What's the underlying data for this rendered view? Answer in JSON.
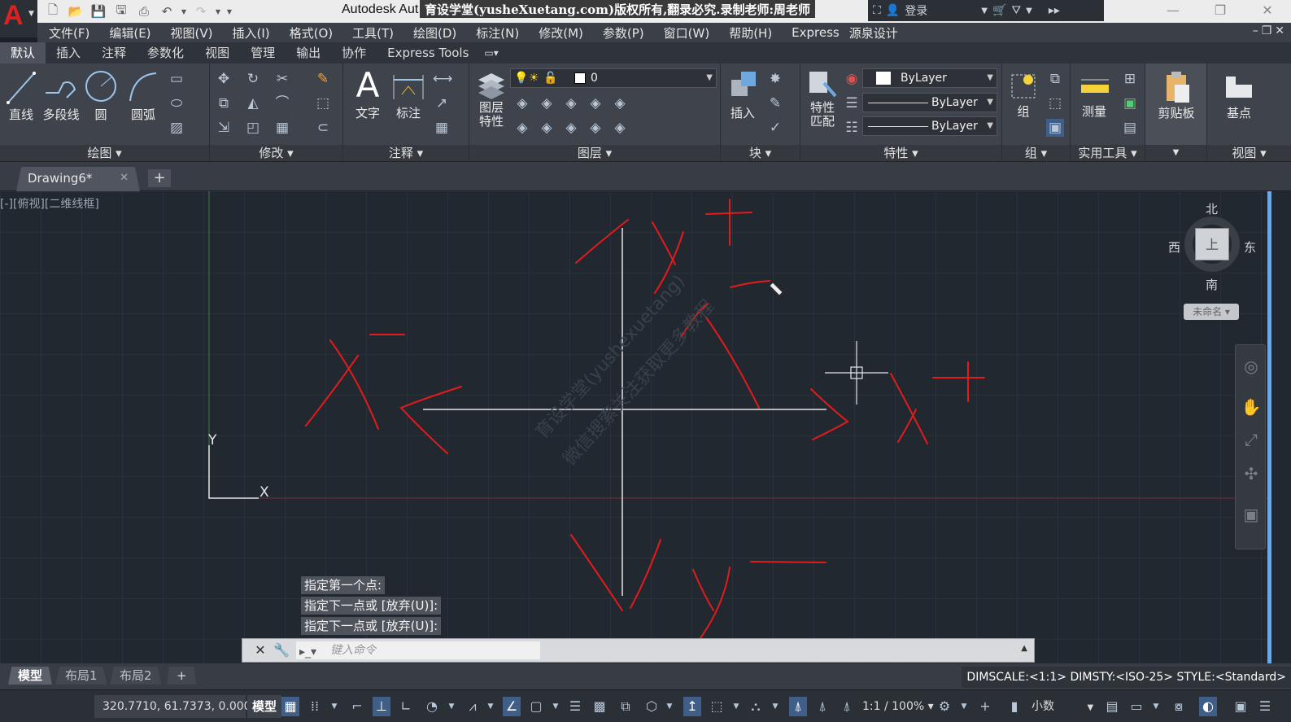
{
  "app": {
    "title": "Autodesk Aut",
    "watermark_banner": "育设学堂(yusheXuetang.com)版权所有,翻录必究.录制老师:周老师",
    "login": "登录"
  },
  "menu": [
    "文件(F)",
    "编辑(E)",
    "视图(V)",
    "插入(I)",
    "格式(O)",
    "工具(T)",
    "绘图(D)",
    "标注(N)",
    "修改(M)",
    "参数(P)",
    "窗口(W)",
    "帮助(H)",
    "Express",
    "源泉设计"
  ],
  "ribbon_tabs": [
    "默认",
    "插入",
    "注释",
    "参数化",
    "视图",
    "管理",
    "输出",
    "协作",
    "Express Tools"
  ],
  "ribbon": {
    "draw": {
      "title": "绘图",
      "line": "直线",
      "polyline": "多段线",
      "circle": "圆",
      "arc": "圆弧"
    },
    "modify": {
      "title": "修改"
    },
    "annotation": {
      "title": "注释",
      "text": "文字",
      "dimension": "标注"
    },
    "layers": {
      "title": "图层",
      "layer_props_1": "图层",
      "layer_props_2": "特性",
      "current_layer": "0"
    },
    "block": {
      "title": "块",
      "insert": "插入"
    },
    "properties": {
      "title": "特性",
      "match_1": "特性",
      "match_2": "匹配",
      "color": "ByLayer",
      "linetype": "ByLayer",
      "lineweight": "ByLayer"
    },
    "groups": {
      "title": "组",
      "group": "组"
    },
    "utilities": {
      "title": "实用工具",
      "measure": "测量"
    },
    "clipboard": {
      "title": "剪贴板",
      "label": "剪贴板"
    },
    "view": {
      "title": "视图",
      "basepoint": "基点"
    }
  },
  "file_tab": {
    "name": "Drawing6*"
  },
  "viewport_label": "[-][俯视][二维线框]",
  "viewcube": {
    "north": "北",
    "south": "南",
    "east": "东",
    "west": "西",
    "ucs": "未命名"
  },
  "ucs_icon": {
    "x": "X",
    "y": "Y"
  },
  "command_history": [
    "指定第一个点:",
    "指定下一点或 [放弃(U)]:",
    "指定下一点或 [放弃(U)]:"
  ],
  "command_prompt": "键入命令",
  "layout_tabs": [
    "模型",
    "布局1",
    "布局2"
  ],
  "status": {
    "vars": "DIMSCALE:<1:1> DIMSTY:<ISO-25> STYLE:<Standard>",
    "coords": "320.7710, 61.7373, 0.0000",
    "model": "模型",
    "scale": "1:1 / 100%",
    "units": "小数"
  },
  "colors": {
    "canvas": "#212830",
    "sketch": "#e21b1b",
    "ui_dark": "#3f434b"
  }
}
